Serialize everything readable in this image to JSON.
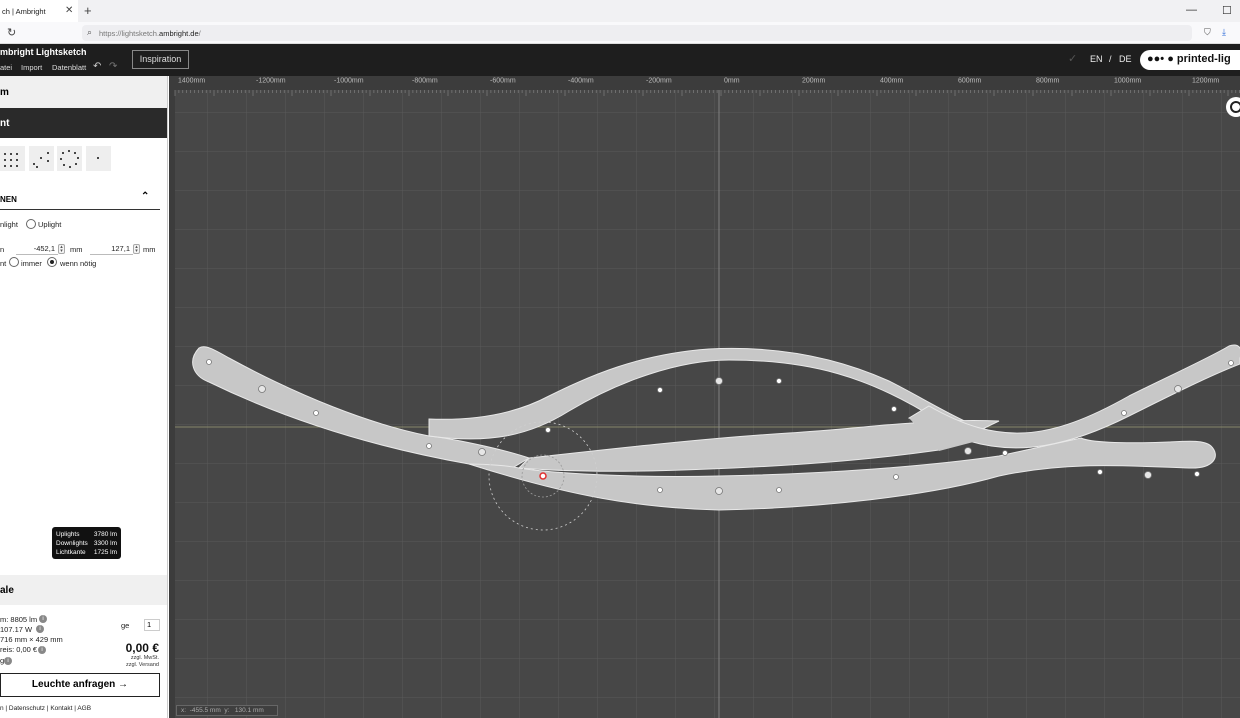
{
  "browser": {
    "tab_title": "ch | Ambright",
    "tab_close": "✕",
    "new_tab": "+",
    "url_prefix": "https://lightsketch.",
    "url_domain": "ambright.de",
    "url_suffix": "/",
    "reload_icon": "↻",
    "minimize": "—",
    "maximize": "☐",
    "shield_icon": "⛉",
    "download_icon": "⤓"
  },
  "app": {
    "title": "mbright Lightsketch",
    "menu": [
      "atei",
      "Import",
      "Datenblatt"
    ],
    "undo": "↶",
    "redo": "↷",
    "inspiration": "Inspiration",
    "lang_en": "EN",
    "lang_sep": "/",
    "lang_de": "DE",
    "brand": "●●• ● printed-lig",
    "checkmark": "✓"
  },
  "sidebar": {
    "section1": "m",
    "section2": "nt",
    "section3": "NEN",
    "section3_chevron": "⌃",
    "downlight_label": "nlight",
    "uplight_label": "Uplight",
    "pos_label": "n",
    "x_value": "-452,1",
    "x_unit": "mm",
    "y_value": "127,1",
    "y_unit": "mm",
    "opt_label": "nt",
    "opt_immer": "immer",
    "opt_wenn": "wenn nötig",
    "section4": "ale",
    "lumen": "m: 8805 lm",
    "watt": "107.17 W",
    "size": "716 mm × 429 mm",
    "preis": "reis: 0,00 €",
    "misc": "g",
    "qty_label": "ge",
    "qty_value": "1",
    "price": "0,00 €",
    "price_note1": "zzgl. MwSt.",
    "price_note2": "zzgl. Versand",
    "cta": "Leuchte anfragen →",
    "footer": "n | Datenschutz | Kontakt | AGB"
  },
  "tooltip": {
    "rows": [
      {
        "label": "Uplights",
        "value": "3780 lm"
      },
      {
        "label": "Downlights",
        "value": "3300 lm"
      },
      {
        "label": "Lichtkante",
        "value": "1725 lm"
      }
    ]
  },
  "canvas": {
    "ruler_labels": [
      "1400mm",
      "-1200mm",
      "-1000mm",
      "-800mm",
      "-600mm",
      "-400mm",
      "-200mm",
      "0mm",
      "200mm",
      "400mm",
      "600mm",
      "800mm",
      "1000mm",
      "1200mm"
    ],
    "cursor_x_label": "x:",
    "cursor_x": "-455.5 mm",
    "cursor_y_label": "y:",
    "cursor_y": "130.1 mm"
  },
  "colors": {
    "canvas_bg": "#474747",
    "shape_fill": "#c8c8c8",
    "appbar": "#1e1e1e",
    "selected_led": "#e03030"
  }
}
